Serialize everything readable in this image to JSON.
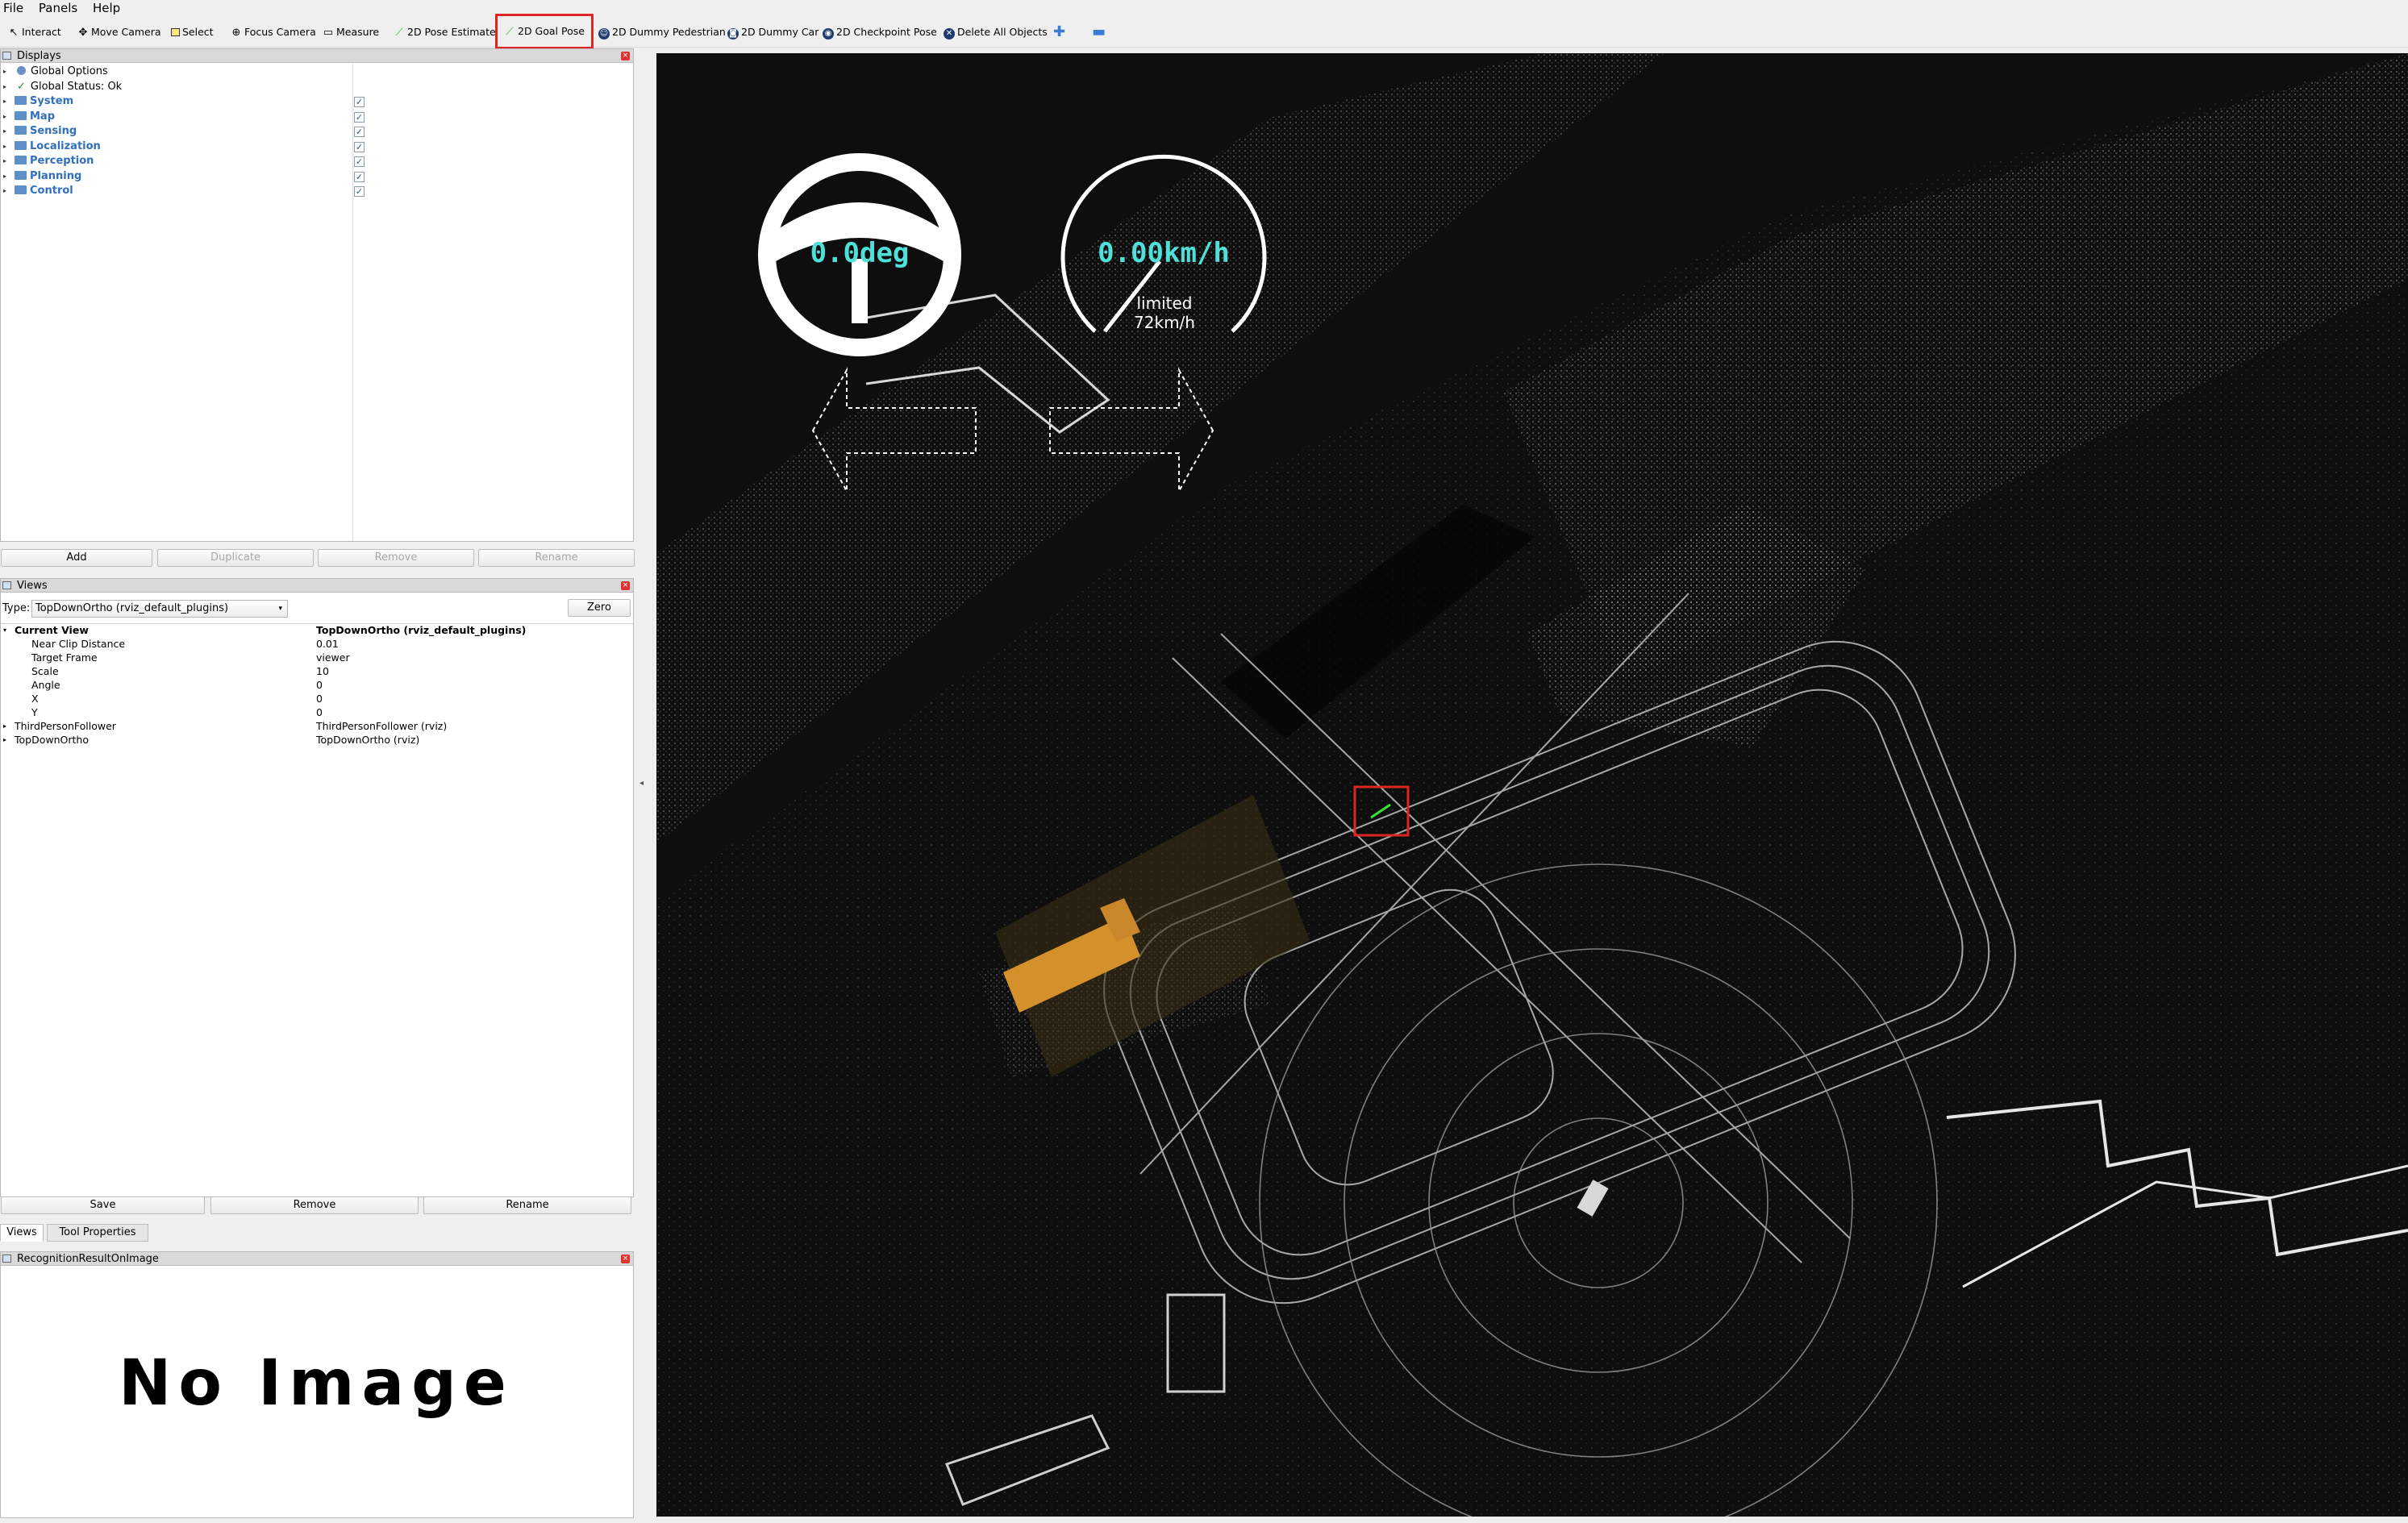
{
  "menu": {
    "file": "File",
    "panels": "Panels",
    "help": "Help"
  },
  "toolbar": {
    "interact": "Interact",
    "move_camera": "Move Camera",
    "select": "Select",
    "focus_camera": "Focus Camera",
    "measure": "Measure",
    "pose_estimate": "2D Pose Estimate",
    "goal_pose": "2D Goal Pose",
    "dummy_pedestrian": "2D Dummy Pedestrian",
    "dummy_car": "2D Dummy Car",
    "checkpoint_pose": "2D Checkpoint Pose",
    "delete_all": "Delete All Objects"
  },
  "displays": {
    "title": "Displays",
    "global_options": "Global Options",
    "global_status": "Global Status: Ok",
    "items": [
      {
        "label": "System",
        "checked": true
      },
      {
        "label": "Map",
        "checked": true
      },
      {
        "label": "Sensing",
        "checked": true
      },
      {
        "label": "Localization",
        "checked": true
      },
      {
        "label": "Perception",
        "checked": true
      },
      {
        "label": "Planning",
        "checked": true
      },
      {
        "label": "Control",
        "checked": true
      }
    ],
    "buttons": {
      "add": "Add",
      "duplicate": "Duplicate",
      "remove": "Remove",
      "rename": "Rename"
    }
  },
  "views": {
    "title": "Views",
    "type_label": "Type:",
    "type_value": "TopDownOrtho (rviz_default_plugins)",
    "zero": "Zero",
    "current_view": {
      "label": "Current View",
      "value": "TopDownOrtho (rviz_default_plugins)"
    },
    "props": [
      {
        "key": "Near Clip Distance",
        "value": "0.01"
      },
      {
        "key": "Target Frame",
        "value": "viewer"
      },
      {
        "key": "Scale",
        "value": "10"
      },
      {
        "key": "Angle",
        "value": "0"
      },
      {
        "key": "X",
        "value": "0"
      },
      {
        "key": "Y",
        "value": "0"
      }
    ],
    "saved": [
      {
        "key": "ThirdPersonFollower",
        "value": "ThirdPersonFollower (rviz)"
      },
      {
        "key": "TopDownOrtho",
        "value": "TopDownOrtho (rviz)"
      }
    ],
    "buttons": {
      "save": "Save",
      "remove": "Remove",
      "rename": "Rename"
    },
    "tabs": {
      "views": "Views",
      "tool_properties": "Tool Properties"
    }
  },
  "image_panel": {
    "title": "RecognitionResultOnImage",
    "no_image": "No Image"
  },
  "hud": {
    "steering": "0.0deg",
    "speed": "0.00km/h",
    "limit_line1": "limited",
    "limit_line2": "72km/h",
    "accent": "#4fe0d9"
  },
  "colors": {
    "highlight": "#e02424",
    "object": "#d4902a",
    "link_blue": "#2f6fbe"
  }
}
